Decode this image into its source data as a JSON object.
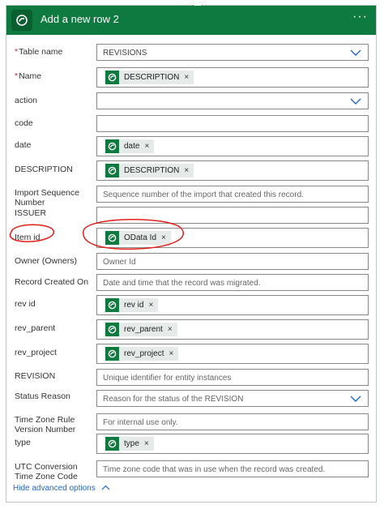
{
  "header": {
    "title": "Add a new row 2",
    "more": "···"
  },
  "fields": {
    "table_name": {
      "label": "Table name",
      "required": "*",
      "value": "REVISIONS"
    },
    "name": {
      "label": "Name",
      "required": "*",
      "token": "DESCRIPTION"
    },
    "action": {
      "label": "action"
    },
    "code": {
      "label": "code"
    },
    "date": {
      "label": "date",
      "token": "date"
    },
    "description": {
      "label": "DESCRIPTION",
      "token": "DESCRIPTION"
    },
    "import_seq": {
      "label": "Import Sequence Number",
      "placeholder": "Sequence number of the import that created this record."
    },
    "issuer": {
      "label": "ISSUER"
    },
    "item_id": {
      "label": "Item id",
      "token": "OData Id"
    },
    "owner": {
      "label": "Owner (Owners)",
      "placeholder": "Owner Id"
    },
    "record_created": {
      "label": "Record Created On",
      "placeholder": "Date and time that the record was migrated."
    },
    "rev_id": {
      "label": "rev id",
      "token": "rev id"
    },
    "rev_parent": {
      "label": "rev_parent",
      "token": "rev_parent"
    },
    "rev_project": {
      "label": "rev_project",
      "token": "rev_project"
    },
    "revision": {
      "label": "REVISION",
      "placeholder": "Unique identifier for entity instances"
    },
    "status_reason": {
      "label": "Status Reason",
      "placeholder": "Reason for the status of the REVISION"
    },
    "tz_rule": {
      "label": "Time Zone Rule Version Number",
      "placeholder": "For internal use only."
    },
    "type": {
      "label": "type",
      "token": "type"
    },
    "utc_conv": {
      "label": "UTC Conversion Time Zone Code",
      "placeholder": "Time zone code that was in use when the record was created."
    }
  },
  "token_remove": "×",
  "footer": {
    "link": "Hide advanced options"
  },
  "colors": {
    "brand": "#0f7a3f",
    "link": "#2266cc",
    "annotation": "#e0201c"
  }
}
